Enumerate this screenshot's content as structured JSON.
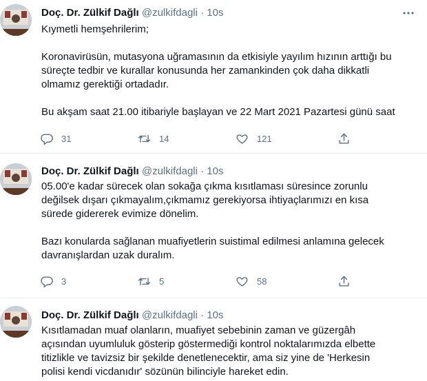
{
  "tweets": [
    {
      "author": {
        "name": "Doç. Dr. Zülkif Dağlı",
        "handle": "@zulkifdagli",
        "time": "10s"
      },
      "lines": [
        "Kıymetli hemşehrilerim;",
        "",
        "Koronavirüsün, mutasyona uğramasının da etkisiyle yayılım hızının arttığı bu",
        "süreçte tedbir ve kurallar konusunda her zamankinden çok daha dikkatli",
        "olmamız gerektiği ortadadır.",
        "",
        "Bu akşam saat 21.00 itibariyle başlayan ve 22 Mart 2021 Pazartesi günü saat"
      ],
      "stats": {
        "replies": "31",
        "retweets": "14",
        "likes": "121"
      }
    },
    {
      "author": {
        "name": "Doç. Dr. Zülkif Dağlı",
        "handle": "@zulkifdagli",
        "time": "10s"
      },
      "lines": [
        "05.00'e kadar sürecek olan sokağa çıkma kısıtlaması süresince zorunlu",
        "değilsek dışarı çıkmayalım,çıkmamız gerekiyorsa ihtiyaçlarımızı en kısa",
        "sürede gidererek evimize dönelim.",
        "",
        "Bazı konularda sağlanan muafiyetlerin suistimal edilmesi anlamına gelecek",
        "davranışlardan uzak duralım."
      ],
      "stats": {
        "replies": "3",
        "retweets": "5",
        "likes": "58"
      }
    },
    {
      "author": {
        "name": "Doç. Dr. Zülkif Dağlı",
        "handle": "@zulkifdagli",
        "time": "10s"
      },
      "lines": [
        "Kısıtlamadan muaf olanların, muafiyet sebebinin zaman ve güzergâh",
        "açısından uyumluluk gösterip göstermediği kontrol noktalarımızda elbette",
        "titizlikle ve tavizsiz bir şekilde denetlenecektir,  ama siz yine de  'Herkesin",
        "polisi kendi vicdanıdır' sözünün bilinciyle hareket edin."
      ],
      "stats": null
    }
  ],
  "icons": {
    "reply": "reply-icon",
    "retweet": "retweet-icon",
    "like": "like-icon",
    "share": "share-icon",
    "more": "more-icon"
  },
  "colors": {
    "text": "#0f1419",
    "muted": "#5b7083",
    "divider": "#e6ecf0"
  }
}
